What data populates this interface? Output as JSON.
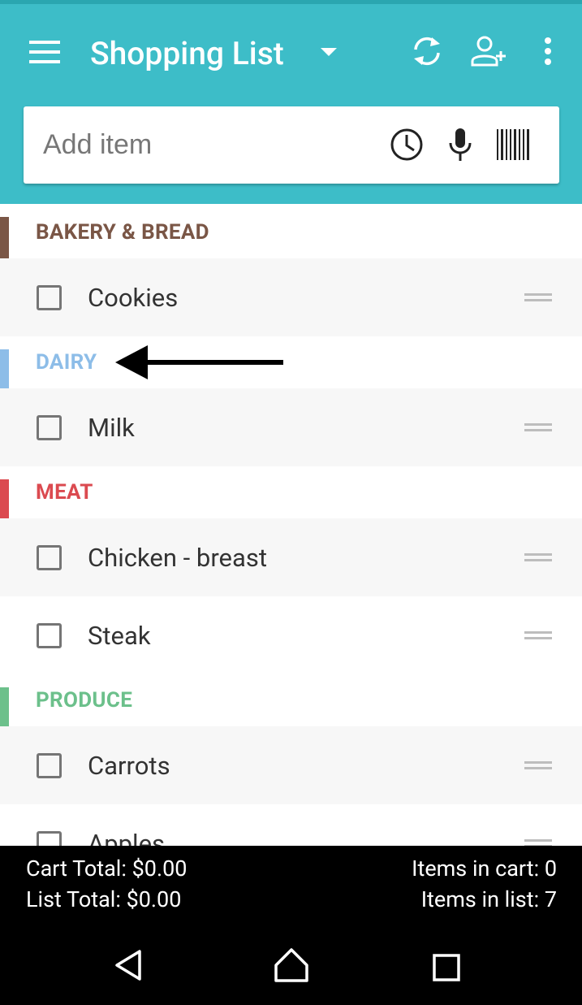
{
  "app": {
    "title": "Shopping List"
  },
  "toolbar": {
    "menu_icon": "hamburger-menu-icon",
    "dropdown_icon": "caret-down-icon",
    "sync_icon": "sync-icon",
    "share_icon": "add-person-icon",
    "more_icon": "more-vert-icon"
  },
  "search": {
    "placeholder": "Add item",
    "history_icon": "clock-icon",
    "voice_icon": "microphone-icon",
    "barcode_icon": "barcode-icon"
  },
  "categories": [
    {
      "name": "BAKERY & BREAD",
      "color": "#7a5646",
      "items": [
        "Cookies"
      ]
    },
    {
      "name": "DAIRY",
      "color": "#8dbde8",
      "items": [
        "Milk"
      ]
    },
    {
      "name": "MEAT",
      "color": "#db4a50",
      "items": [
        "Chicken - breast",
        "Steak"
      ]
    },
    {
      "name": "PRODUCE",
      "color": "#6cc08b",
      "items": [
        "Carrots",
        "Apples"
      ]
    }
  ],
  "footer": {
    "cart_total": "Cart Total: $0.00",
    "list_total": "List Total: $0.00",
    "items_in_cart": "Items in cart: 0",
    "items_in_list": "Items in list: 7"
  },
  "colors": {
    "appbar": "#3dbdc8",
    "statusbar": "#2aa6b0"
  }
}
